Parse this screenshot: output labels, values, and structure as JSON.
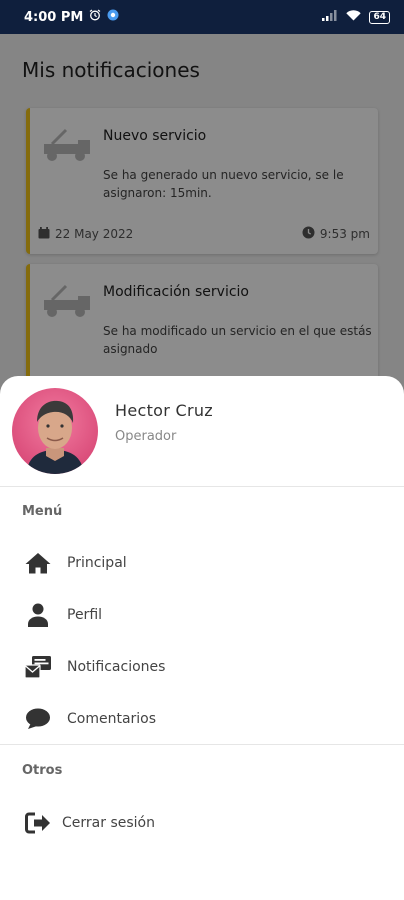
{
  "status_bar": {
    "time": "4:00 PM",
    "battery": "64"
  },
  "page": {
    "title": "Mis notificaciones",
    "notifications": [
      {
        "title": "Nuevo servicio",
        "body": "Se ha generado un nuevo servicio, se le asignaron: 15min.",
        "date": "22 May 2022",
        "time": "9:53 pm"
      },
      {
        "title": "Modificación servicio",
        "body": "Se ha modificado un servicio en el que estás asignado"
      }
    ]
  },
  "drawer": {
    "user": {
      "name": "Hector Cruz",
      "role": "Operador"
    },
    "menu_heading": "Menú",
    "menu_items": [
      {
        "label": "Principal",
        "icon": "home-icon"
      },
      {
        "label": "Perfil",
        "icon": "person-icon"
      },
      {
        "label": "Notificaciones",
        "icon": "notifications-icon"
      },
      {
        "label": "Comentarios",
        "icon": "comment-icon"
      }
    ],
    "other_heading": "Otros",
    "logout_label": "Cerrar sesión"
  },
  "colors": {
    "status_bar": "#0f1f3d",
    "accent": "#f0c419"
  }
}
